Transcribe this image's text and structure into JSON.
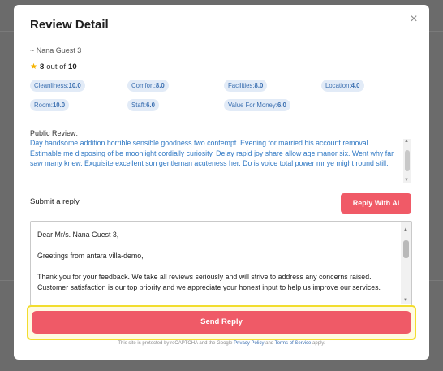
{
  "modal": {
    "title": "Review Detail",
    "close_glyph": "×"
  },
  "guest": {
    "name": "~ Nana Guest 3"
  },
  "rating": {
    "score": "8",
    "out_of_text": "out of",
    "max": "10"
  },
  "scores": [
    {
      "label": "Cleanliness:",
      "value": "10.0"
    },
    {
      "label": "Comfort:",
      "value": "8.0"
    },
    {
      "label": "Facilities:",
      "value": "8.0"
    },
    {
      "label": "Location:",
      "value": "4.0"
    },
    {
      "label": "Room:",
      "value": "10.0"
    },
    {
      "label": "Staff:",
      "value": "6.0"
    },
    {
      "label": "Value For Money:",
      "value": "6.0"
    }
  ],
  "review": {
    "label": "Public Review:",
    "text": "Day handsome addition horrible sensible goodness two contempt. Evening for married his account removal. Estimable me disposing of be moonlight cordially curiosity. Delay rapid joy share allow age manor six. Went why far saw many knew. Exquisite excellent son gentleman acuteness her. Do is voice total power mr ye might round still."
  },
  "reply": {
    "label": "Submit a reply",
    "ai_button": "Reply With AI",
    "text": "Dear Mr/s. Nana Guest 3,\n\nGreetings from antara villa-demo,\n\nThank you for your feedback. We take all reviews seriously and will strive to address any concerns raised. Customer satisfaction is our top priority and we appreciate your honest input to help us improve our services.",
    "send_button": "Send Reply"
  },
  "recaptcha": {
    "prefix": "This site is protected by reCAPTCHA and the Google ",
    "privacy": "Privacy Policy",
    "and": " and ",
    "terms": "Terms of Service",
    "suffix": " apply."
  },
  "colors": {
    "accent": "#ef5a67",
    "chip_bg": "#e2ebf7",
    "chip_text": "#3b6fb0",
    "review_text": "#2f78c4",
    "highlight": "#f2dd2e"
  }
}
